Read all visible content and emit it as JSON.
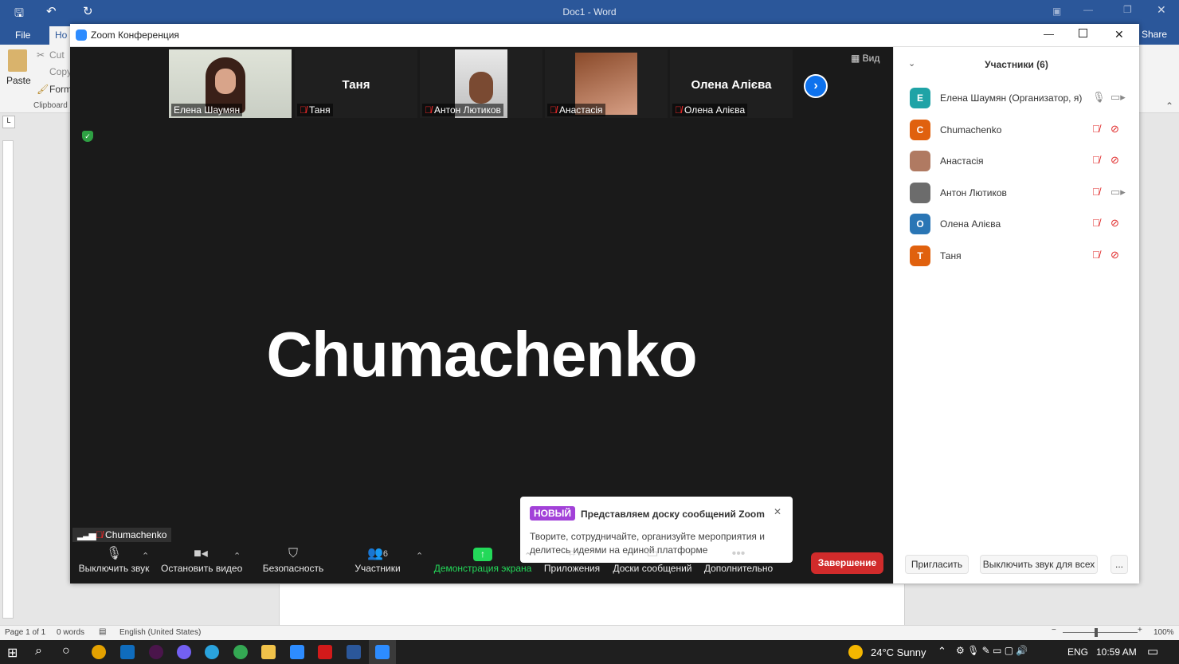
{
  "word": {
    "title": "Doc1 - Word",
    "tab_file": "File",
    "tab_home": "Ho",
    "share": "Share",
    "ribbon": {
      "paste": "Paste",
      "cut": "Cut",
      "copy": "Copy",
      "format": "Form",
      "clipboard": "Clipboard"
    },
    "status": {
      "page": "Page 1 of 1",
      "words": "0 words",
      "language": "English (United States)",
      "zoom": "100%"
    }
  },
  "taskbar": {
    "weather": "24°C  Sunny",
    "lang": "ENG",
    "time": "10:59 AM"
  },
  "zoom": {
    "title": "Zoom Конференция",
    "view_label": "Вид",
    "thumbs": [
      {
        "name": "Елена Шаумян",
        "big": "",
        "muted": false
      },
      {
        "name": "Таня",
        "big": "Таня",
        "muted": true
      },
      {
        "name": "Антон Лютиков",
        "big": "",
        "muted": true
      },
      {
        "name": "Анастасія",
        "big": "",
        "muted": true
      },
      {
        "name": "Олена Алієва",
        "big": "Олена Алієва",
        "muted": true
      }
    ],
    "speaker_name": "Chumachenko",
    "speaker_tag": "Chumachenko",
    "participants_count": "6",
    "toolbar": {
      "mute": "Выключить звук",
      "video": "Остановить видео",
      "security": "Безопасность",
      "participants": "Участники",
      "share": "Демонстрация экрана",
      "apps": "Приложения",
      "whiteboards": "Доски сообщений",
      "more": "Дополнительно",
      "end": "Завершение"
    },
    "popup": {
      "badge": "НОВЫЙ",
      "title": "Представляем доску сообщений Zoom",
      "body_line1": "Творите, сотрудничайте, организуйте мероприятия и",
      "body_line2": "делитесь идеями на единой платформе"
    },
    "panel": {
      "title": "Участники (6)",
      "participants": [
        {
          "initial": "E",
          "name": "Елена Шаумян (Организатор, я)",
          "color": "#1fa3a6",
          "mic": "on",
          "cam": "on"
        },
        {
          "initial": "C",
          "name": "Chumachenko",
          "color": "#e0610e",
          "mic": "off",
          "cam": "off"
        },
        {
          "initial": "",
          "name": "Анастасія",
          "color": "#b07a62",
          "mic": "off",
          "cam": "off"
        },
        {
          "initial": "",
          "name": "Антон Лютиков",
          "color": "#6c6c6c",
          "mic": "off",
          "cam": "on"
        },
        {
          "initial": "О",
          "name": "Олена Алієва",
          "color": "#2a76b5",
          "mic": "off",
          "cam": "off"
        },
        {
          "initial": "Т",
          "name": "Таня",
          "color": "#e0610e",
          "mic": "off",
          "cam": "off"
        }
      ],
      "invite": "Пригласить",
      "mute_all": "Выключить звук для всех",
      "more": "..."
    }
  }
}
